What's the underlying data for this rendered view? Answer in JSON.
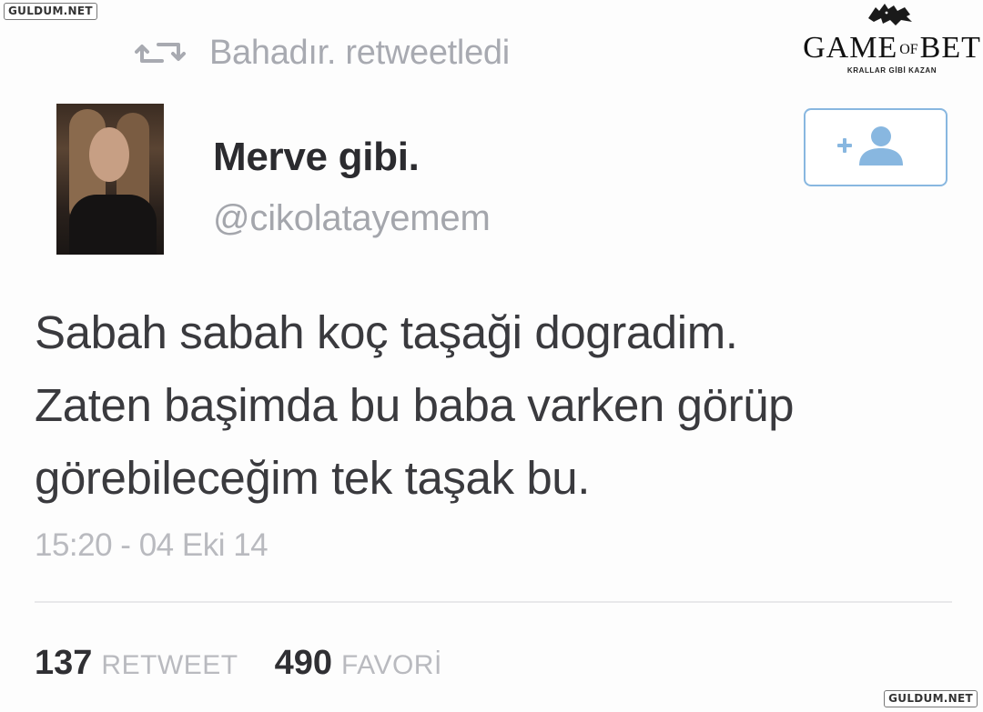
{
  "watermark": {
    "top": "GULDUM.NET",
    "bottom": "GULDUM.NET"
  },
  "brand": {
    "name_left": "GAME",
    "name_of": "OF",
    "name_right": "BET",
    "tagline": "KRALLAR GİBİ KAZAN"
  },
  "retweet": {
    "text": "Bahadır. retweetledi",
    "icon": "retweet-icon"
  },
  "user": {
    "display_name": "Merve gibi.",
    "handle": "@cikolatayemem",
    "follow_icon": "add-user-icon"
  },
  "tweet": {
    "lines": [
      "Sabah sabah koç taşaği dogradim.",
      "Zaten başimda bu baba varken görüp",
      "görebileceğim tek taşak bu."
    ],
    "timestamp": "15:20 - 04 Eki 14"
  },
  "stats": {
    "retweets": {
      "count": "137",
      "label": "RETWEET"
    },
    "favorites": {
      "count": "490",
      "label": "FAVORİ"
    }
  },
  "colors": {
    "accent": "#88b7e0",
    "muted": "#a8aab1",
    "text": "#3a3a3e"
  }
}
